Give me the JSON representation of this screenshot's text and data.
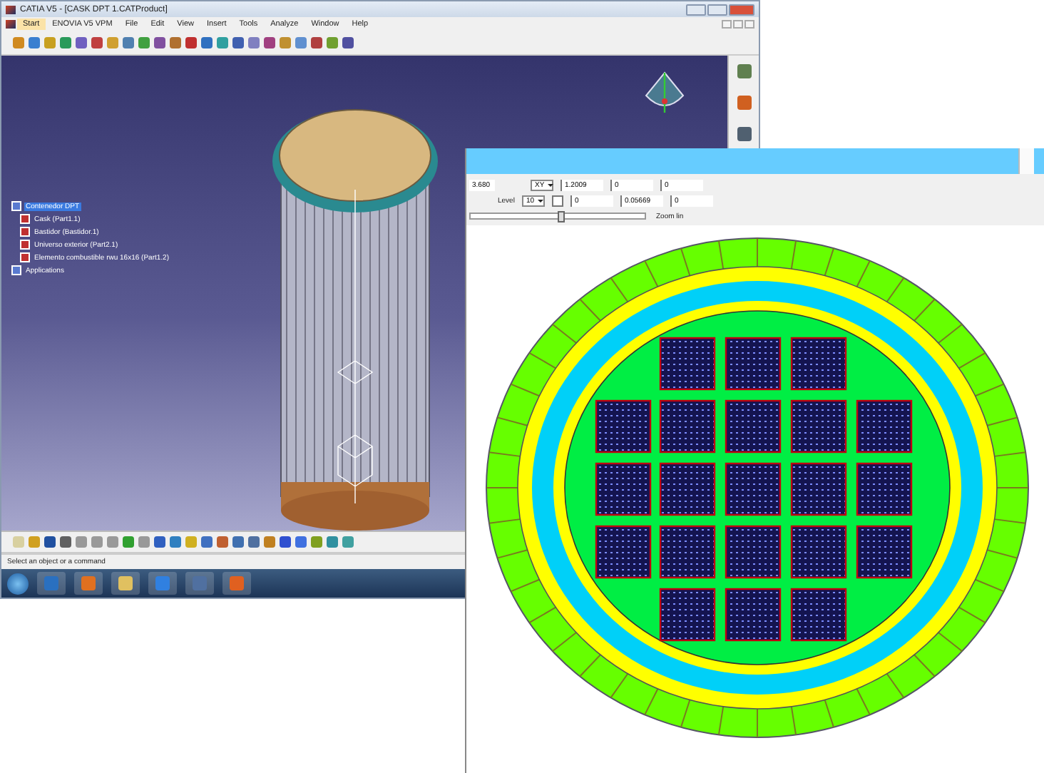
{
  "catia_window": {
    "title": "CATIA V5 - [CASK DPT 1.CATProduct]",
    "menu": [
      {
        "label": "Start",
        "selected": true
      },
      {
        "label": "ENOVIA V5 VPM",
        "selected": false
      },
      {
        "label": "File",
        "selected": false
      },
      {
        "label": "Edit",
        "selected": false
      },
      {
        "label": "View",
        "selected": false
      },
      {
        "label": "Insert",
        "selected": false
      },
      {
        "label": "Tools",
        "selected": false
      },
      {
        "label": "Analyze",
        "selected": false
      },
      {
        "label": "Window",
        "selected": false
      },
      {
        "label": "Help",
        "selected": false
      }
    ],
    "tree": [
      {
        "label": "Contenedor DPT",
        "selected": true,
        "children": [
          {
            "label": "Cask (Part1.1)",
            "selected": false
          },
          {
            "label": "Bastidor (Bastidor.1)",
            "selected": false
          },
          {
            "label": "Universo exterior (Part2.1)",
            "selected": false
          },
          {
            "label": "Elemento combustible rwu 16x16 (Part1.2)",
            "selected": false
          }
        ]
      },
      {
        "label": "Applications",
        "selected": false
      }
    ],
    "status_bar": "Select an object or a command"
  },
  "viewer_window": {
    "row_1": {
      "value_field": "3.680",
      "plane_dropdown": "XY",
      "fields": [
        "1.2009",
        "0",
        "0"
      ]
    },
    "row_2": {
      "label": "Level",
      "level_dropdown": "10",
      "checkbox_checked": false,
      "fields": [
        "0",
        "0.05669",
        "0"
      ]
    },
    "zoom_slider": {
      "level": 0.5,
      "label": "Zoom lin"
    }
  }
}
